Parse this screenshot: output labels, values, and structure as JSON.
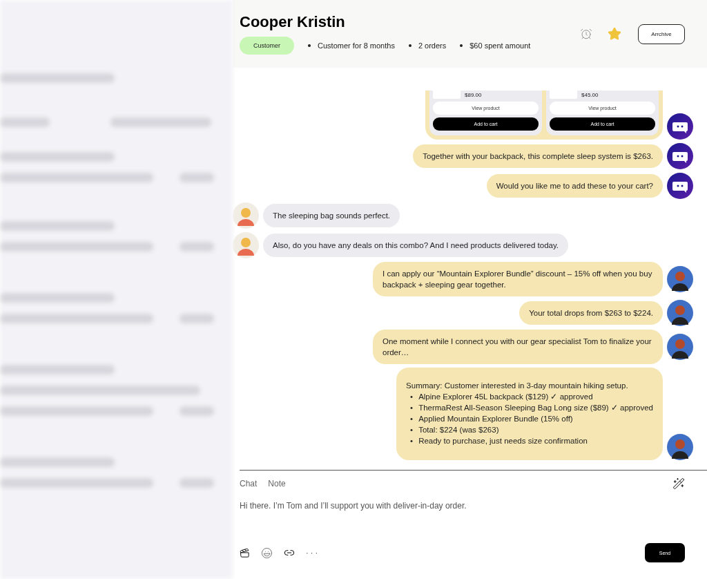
{
  "header": {
    "name": "Cooper Kristin",
    "badge": "Customer",
    "facts": [
      "Customer for 8 months",
      "2 orders",
      "$60 spent amount"
    ],
    "starred": true,
    "archive_button": "Arrchive"
  },
  "messages": [
    {
      "kind": "bot_products",
      "products": [
        {
          "price": "$89.00",
          "view_button": "View product",
          "cart_button": "Add to cart"
        },
        {
          "price": "$45.00",
          "view_button": "View product",
          "cart_button": "Add to cart"
        }
      ]
    },
    {
      "kind": "bot_text",
      "text": "Together with your backpack, this complete sleep system is $263."
    },
    {
      "kind": "bot_text",
      "text": "Would you like me to add these to your cart?"
    },
    {
      "kind": "customer_text",
      "text": "The sleeping bag sounds perfect."
    },
    {
      "kind": "customer_text",
      "text": "Also, do you have any deals on this combo? And I need products delivered today."
    },
    {
      "kind": "agent_text",
      "text": "I can apply our “Mountain Explorer Bundle” discount – 15% off when you buy backpack + sleeping gear together."
    },
    {
      "kind": "agent_text",
      "text": "Your total drops from $263 to $224."
    },
    {
      "kind": "agent_text",
      "text": "One moment while I connect you with our gear specialist Tom to finalize your order…"
    },
    {
      "kind": "agent_summary",
      "text": "Summary: Customer interested in 3-day mountain hiking setup.",
      "bullet": "•",
      "bullets": [
        "Alpine Explorer 45L backpack ($129) ✓ approved",
        "ThermaRest All-Season Sleeping Bag Long size ($89) ✓ approved",
        "Applied Mountain Explorer Bundle (15% off)",
        "Total: $224 (was $263)",
        "Ready to purchase, just needs size confirmation"
      ]
    }
  ],
  "composer": {
    "tabs": [
      "Chat",
      "Note"
    ],
    "value": "Hi there. I’m Tom and I’ll support you with deliver-in-day order.",
    "more": "· · ·",
    "send_button": "Send"
  }
}
